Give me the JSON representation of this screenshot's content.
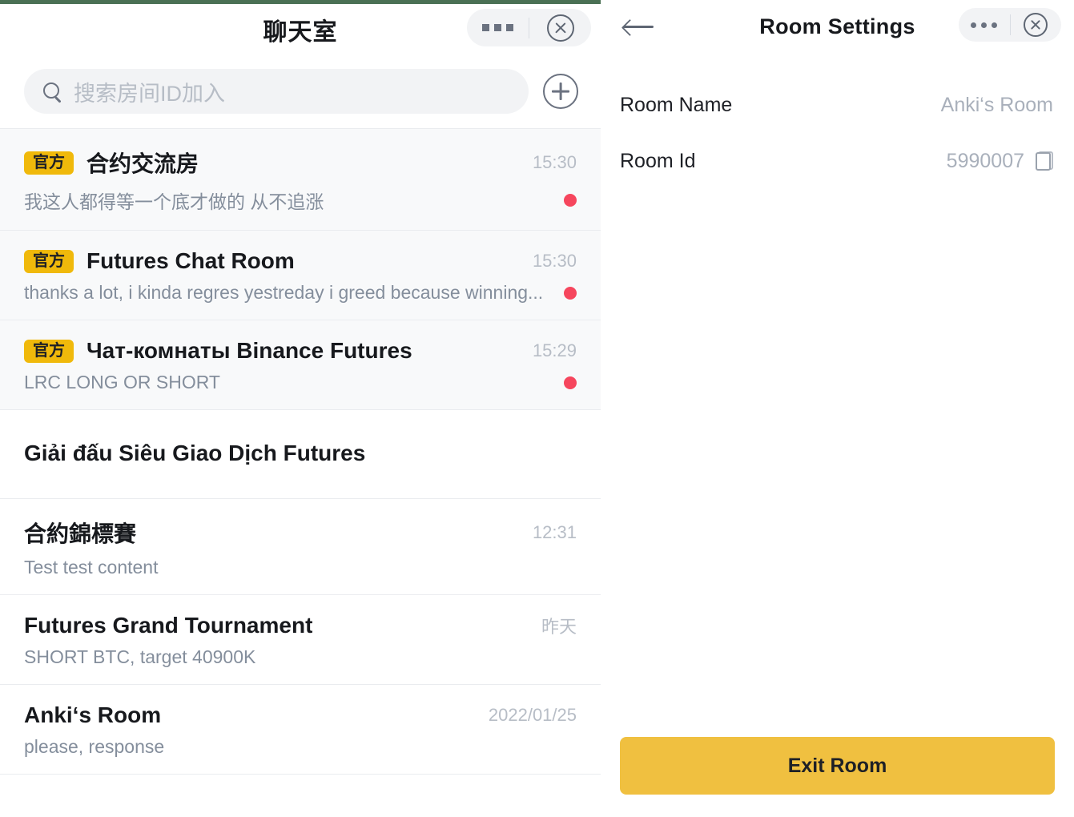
{
  "left": {
    "status_bar_color": "#4a7054",
    "header": {
      "title": "聊天室",
      "more_icon": "more-horizontal-icon",
      "close_icon": "close-circle-icon"
    },
    "search": {
      "placeholder": "搜索房间ID加入",
      "icon": "search-icon",
      "add_icon": "plus-circle-icon"
    },
    "official_badge": "官方",
    "items": [
      {
        "badge": "官方",
        "name": "合约交流房",
        "time": "15:30",
        "preview": "我这人都得等一个底才做的 从不追涨",
        "unread": true,
        "highlight": true
      },
      {
        "badge": "官方",
        "name": "Futures Chat Room",
        "time": "15:30",
        "preview": "thanks a lot, i kinda regres yestreday i greed because winning...",
        "unread": true,
        "highlight": true
      },
      {
        "badge": "官方",
        "name": "Чат-комнаты Binance Futures",
        "time": "15:29",
        "preview": "LRC LONG OR SHORT",
        "unread": true,
        "highlight": true
      }
    ],
    "section_header": "Giải đấu Siêu Giao Dịch Futures",
    "rooms": [
      {
        "name": "合約錦標賽",
        "time": "12:31",
        "preview": "Test test content",
        "unread": false
      },
      {
        "name": "Futures Grand Tournament",
        "time": "昨天",
        "preview": "SHORT BTC, target 40900K",
        "unread": false
      },
      {
        "name": "Anki‘s Room",
        "time": "2022/01/25",
        "preview": "please, response",
        "unread": false
      }
    ]
  },
  "right": {
    "header": {
      "title": "Room Settings",
      "back_icon": "arrow-left-icon",
      "more_icon": "more-horizontal-icon",
      "close_icon": "close-circle-icon"
    },
    "settings": [
      {
        "label": "Room Name",
        "value": "Anki‘s Room",
        "copyable": false
      },
      {
        "label": "Room Id",
        "value": "5990007",
        "copyable": true
      }
    ],
    "exit_button": "Exit Room",
    "accent_color": "#F0C040"
  },
  "colors": {
    "badge_yellow": "#F0B90B",
    "unread_red": "#F6465D",
    "muted_row_bg": "#F8F9FA",
    "divider": "#EAECEF"
  }
}
